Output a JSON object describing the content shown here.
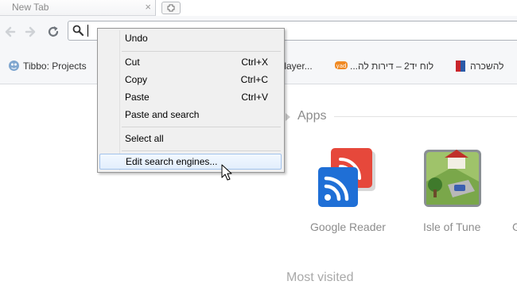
{
  "tab": {
    "title": "New Tab",
    "close": "×"
  },
  "toolbar": {
    "omnibox_value": ""
  },
  "bookmarks": [
    {
      "label": "Tibbo: Projects"
    },
    {
      "label": "ltiplayer..."
    },
    {
      "label": "לוח יד2 – דירות לה..."
    },
    {
      "label": "להשכרה"
    }
  ],
  "context_menu": {
    "items": [
      {
        "label": "Undo",
        "shortcut": ""
      },
      {
        "label": "Cut",
        "shortcut": "Ctrl+X"
      },
      {
        "label": "Copy",
        "shortcut": "Ctrl+C"
      },
      {
        "label": "Paste",
        "shortcut": "Ctrl+V"
      },
      {
        "label": "Paste and search",
        "shortcut": ""
      },
      {
        "label": "Select all",
        "shortcut": ""
      },
      {
        "label": "Edit search engines...",
        "shortcut": ""
      }
    ],
    "highlighted": "Edit search engines..."
  },
  "ntp": {
    "apps_title": "Apps",
    "apps": [
      {
        "name": "Google Reader",
        "icon": "google-reader-icon"
      },
      {
        "name": "Isle of Tune",
        "icon": "isle-of-tune-icon"
      }
    ],
    "partial_app_label": "G",
    "most_visited_title": "Most visited"
  },
  "colors": {
    "menu_bg": "#f0f0f0",
    "menu_highlight_border": "#a4c3eb",
    "ntp_text": "#8c8c8c"
  }
}
